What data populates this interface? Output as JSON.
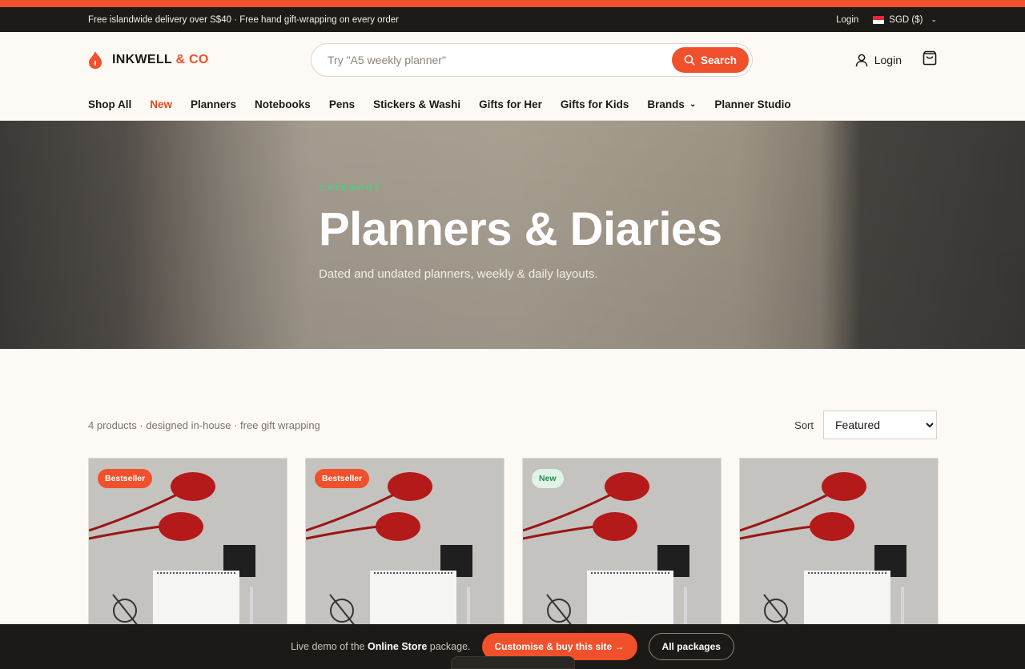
{
  "announcement": {
    "text": "Free islandwide delivery over S$40 · Free hand gift-wrapping on every order",
    "login": "Login",
    "currency": "SGD ($)"
  },
  "header": {
    "brand_main": "INKWELL",
    "brand_accent": "& CO",
    "search_placeholder": "Try \"A5 weekly planner\"",
    "search_button": "Search",
    "login": "Login",
    "icons": [
      "flame-logo-icon",
      "search-icon",
      "user-icon",
      "shopping-bag-icon"
    ]
  },
  "nav": {
    "items": [
      "Shop All",
      "New",
      "Planners",
      "Notebooks",
      "Pens",
      "Stickers & Washi",
      "Gifts for Her",
      "Gifts for Kids",
      "Brands",
      "Planner Studio"
    ],
    "active": "New"
  },
  "hero": {
    "kicker": "CATEGORY",
    "title": "Planners & Diaries",
    "subtitle": "Dated and undated planners, weekly & daily layouts."
  },
  "listing": {
    "count_text": "4 products · designed in-house · free gift wrapping",
    "sort_label": "Sort",
    "sort_selected": "Featured"
  },
  "products": [
    {
      "badge": "Bestseller",
      "badge_type": "best"
    },
    {
      "badge": "Bestseller",
      "badge_type": "best"
    },
    {
      "badge": "New",
      "badge_type": "new"
    },
    {
      "badge": "",
      "badge_type": ""
    }
  ],
  "demo_bar": {
    "text_prefix": "Live demo of the",
    "text_bold": "Online Store",
    "text_suffix": "package.",
    "primary_button": "Customise & buy this site →",
    "secondary_button": "All packages"
  },
  "colors": {
    "accent": "#f0502b",
    "dark": "#1d1b18",
    "background": "#fdf9f4",
    "kicker_green": "#4ccf7e"
  }
}
